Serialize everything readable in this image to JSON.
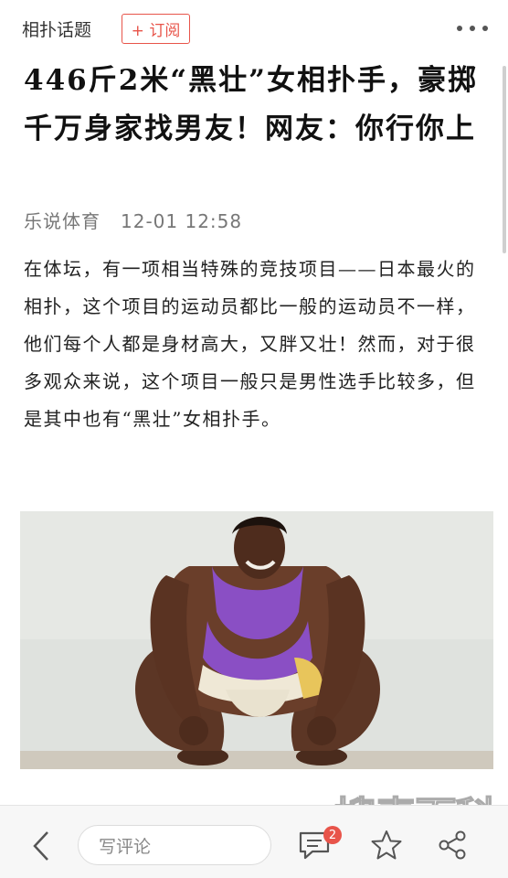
{
  "header": {
    "topic": "相扑话题",
    "follow_label": "+ 订阅"
  },
  "article": {
    "title": "446斤2米“黑壮”女相扑手，豪掷千万身家找男友！网友：你行你上",
    "source": "乐说体育",
    "timestamp": "12-01 12:58",
    "body": "在体坛，有一项相当特殊的竞技项目——日本最火的相扑，这个项目的运动员都比一般的运动员不一样，他们每个人都是身材高大，又胖又壮！然而，对于很多观众来说，这个项目一般只是男性选手比较多，但是其中也有“黑壮”女相扑手。"
  },
  "bottom_bar": {
    "comment_placeholder": "写评论",
    "comment_count": "2"
  },
  "watermark": "搜毒百科",
  "colors": {
    "accent": "#e8544a",
    "photo_bg": "#dfe2de",
    "top_purple": "#8a4fc4"
  },
  "icons": [
    "more-icon",
    "back-icon",
    "comment-icon",
    "star-icon",
    "share-icon"
  ]
}
